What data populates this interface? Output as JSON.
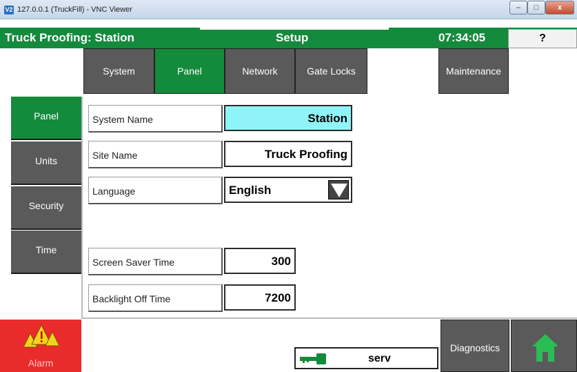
{
  "window": {
    "logo_text": "V2",
    "title": "127.0.0.1 (TruckFill) - VNC Viewer",
    "minimize_label": "–",
    "maximize_label": "□",
    "close_label": "x"
  },
  "header": {
    "title": "Truck Proofing: Station",
    "section": "Setup",
    "time": "07:34:05",
    "help_label": "?"
  },
  "tabs": [
    {
      "label": "System",
      "active": false
    },
    {
      "label": "Panel",
      "active": true
    },
    {
      "label": "Network",
      "active": false
    },
    {
      "label": "Gate Locks",
      "active": false
    },
    {
      "label": "Maintenance",
      "active": false
    }
  ],
  "side_menu": [
    {
      "label": "Panel",
      "active": true
    },
    {
      "label": "Units",
      "active": false
    },
    {
      "label": "Security",
      "active": false
    },
    {
      "label": "Time",
      "active": false
    }
  ],
  "form": {
    "system_name": {
      "label": "System Name",
      "value": "Station"
    },
    "site_name": {
      "label": "Site Name",
      "value": "Truck Proofing"
    },
    "language": {
      "label": "Language",
      "value": "English"
    },
    "screen_saver_time": {
      "label": "Screen Saver Time",
      "value": "300"
    },
    "backlight_off_time": {
      "label": "Backlight Off Time",
      "value": "7200"
    }
  },
  "bottom": {
    "alarm_label": "Alarm",
    "user": "serv",
    "diagnostics_label": "Diagnostics"
  },
  "colors": {
    "brand_green": "#148a3c",
    "button_gray": "#5a5a5a",
    "highlight_cyan": "#8ff4f7",
    "alarm_red": "#ea2b2b"
  }
}
